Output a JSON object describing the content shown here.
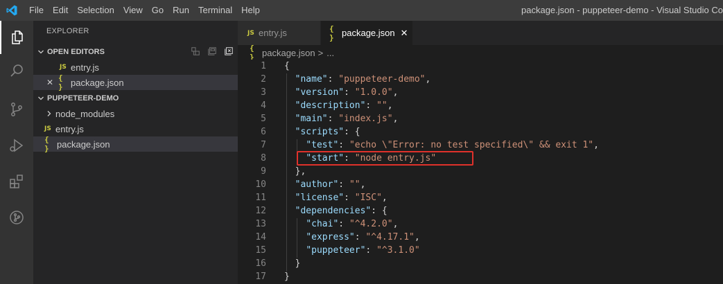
{
  "menu": [
    "File",
    "Edit",
    "Selection",
    "View",
    "Go",
    "Run",
    "Terminal",
    "Help"
  ],
  "window_title": "package.json - puppeteer-demo - Visual Studio Co",
  "sidebar": {
    "title": "EXPLORER",
    "open_editors": {
      "label": "OPEN EDITORS",
      "items": [
        {
          "badge": "JS",
          "name": "entry.js"
        },
        {
          "badge": "{ }",
          "name": "package.json",
          "close": "✕"
        }
      ]
    },
    "project": {
      "label": "PUPPETEER-DEMO",
      "items": [
        {
          "name": "node_modules"
        },
        {
          "badge": "JS",
          "name": "entry.js"
        },
        {
          "badge": "{ }",
          "name": "package.json"
        }
      ]
    }
  },
  "tabs": [
    {
      "badge": "JS",
      "label": "entry.js"
    },
    {
      "badge": "{ }",
      "label": "package.json",
      "close": "✕"
    }
  ],
  "breadcrumb": {
    "badge": "{ }",
    "file": "package.json",
    "sep": ">",
    "more": "..."
  },
  "code_lines": [
    {
      "n": "1"
    },
    {
      "n": "2"
    },
    {
      "n": "3"
    },
    {
      "n": "4"
    },
    {
      "n": "5"
    },
    {
      "n": "6"
    },
    {
      "n": "7"
    },
    {
      "n": "8"
    },
    {
      "n": "9"
    },
    {
      "n": "10"
    },
    {
      "n": "11"
    },
    {
      "n": "12"
    },
    {
      "n": "13"
    },
    {
      "n": "14"
    },
    {
      "n": "15"
    },
    {
      "n": "16"
    },
    {
      "n": "17"
    }
  ],
  "code": {
    "l1": "{",
    "l2k": "\"name\"",
    "l2v": "\"puppeteer-demo\"",
    "l3k": "\"version\"",
    "l3v": "\"1.0.0\"",
    "l4k": "\"description\"",
    "l4v": "\"\"",
    "l5k": "\"main\"",
    "l5v": "\"index.js\"",
    "l6k": "\"scripts\"",
    "l6v": "{",
    "l7k": "\"test\"",
    "l7v": "\"echo \\\"Error: no test specified\\\" && exit 1\"",
    "l8k": "\"start\"",
    "l8v": "\"node entry.js\"",
    "l9": "},",
    "l10k": "\"author\"",
    "l10v": "\"\"",
    "l11k": "\"license\"",
    "l11v": "\"ISC\"",
    "l12k": "\"dependencies\"",
    "l12v": "{",
    "l13k": "\"chai\"",
    "l13v": "\"^4.2.0\"",
    "l14k": "\"express\"",
    "l14v": "\"^4.17.1\"",
    "l15k": "\"puppeteer\"",
    "l15v": "\"^3.1.0\"",
    "l16": "}",
    "l17": "}"
  },
  "colors": {
    "accent_highlight": "#e0312b",
    "json_key": "#9cdcfe",
    "json_string": "#ce9178",
    "vscode_blue": "#23a9f2"
  },
  "icons": [
    "vscode-logo-icon",
    "explorer-icon",
    "search-icon",
    "source-control-icon",
    "run-debug-icon",
    "extensions-icon",
    "git-graph-icon"
  ]
}
